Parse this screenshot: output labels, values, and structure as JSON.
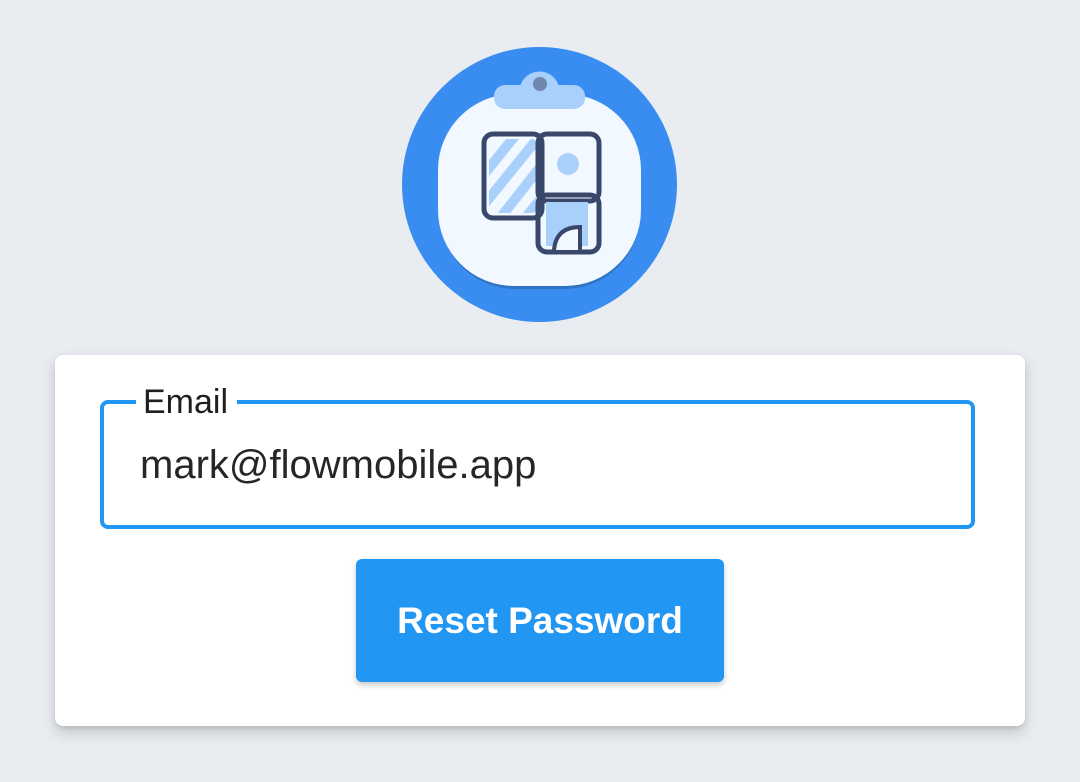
{
  "logo": {
    "icon": "clipboard-gallery-icon",
    "colors": {
      "outer_circle": "#3a8df0",
      "squircle": "#f2f8ff",
      "clip": "#a9cffb",
      "outline": "#39476b",
      "fill_light": "#a9cffb"
    }
  },
  "form": {
    "email_label": "Email",
    "email_value": "mark@flowmobile.app",
    "accent_color": "#2196f3"
  },
  "actions": {
    "reset_label": "Reset Password"
  }
}
